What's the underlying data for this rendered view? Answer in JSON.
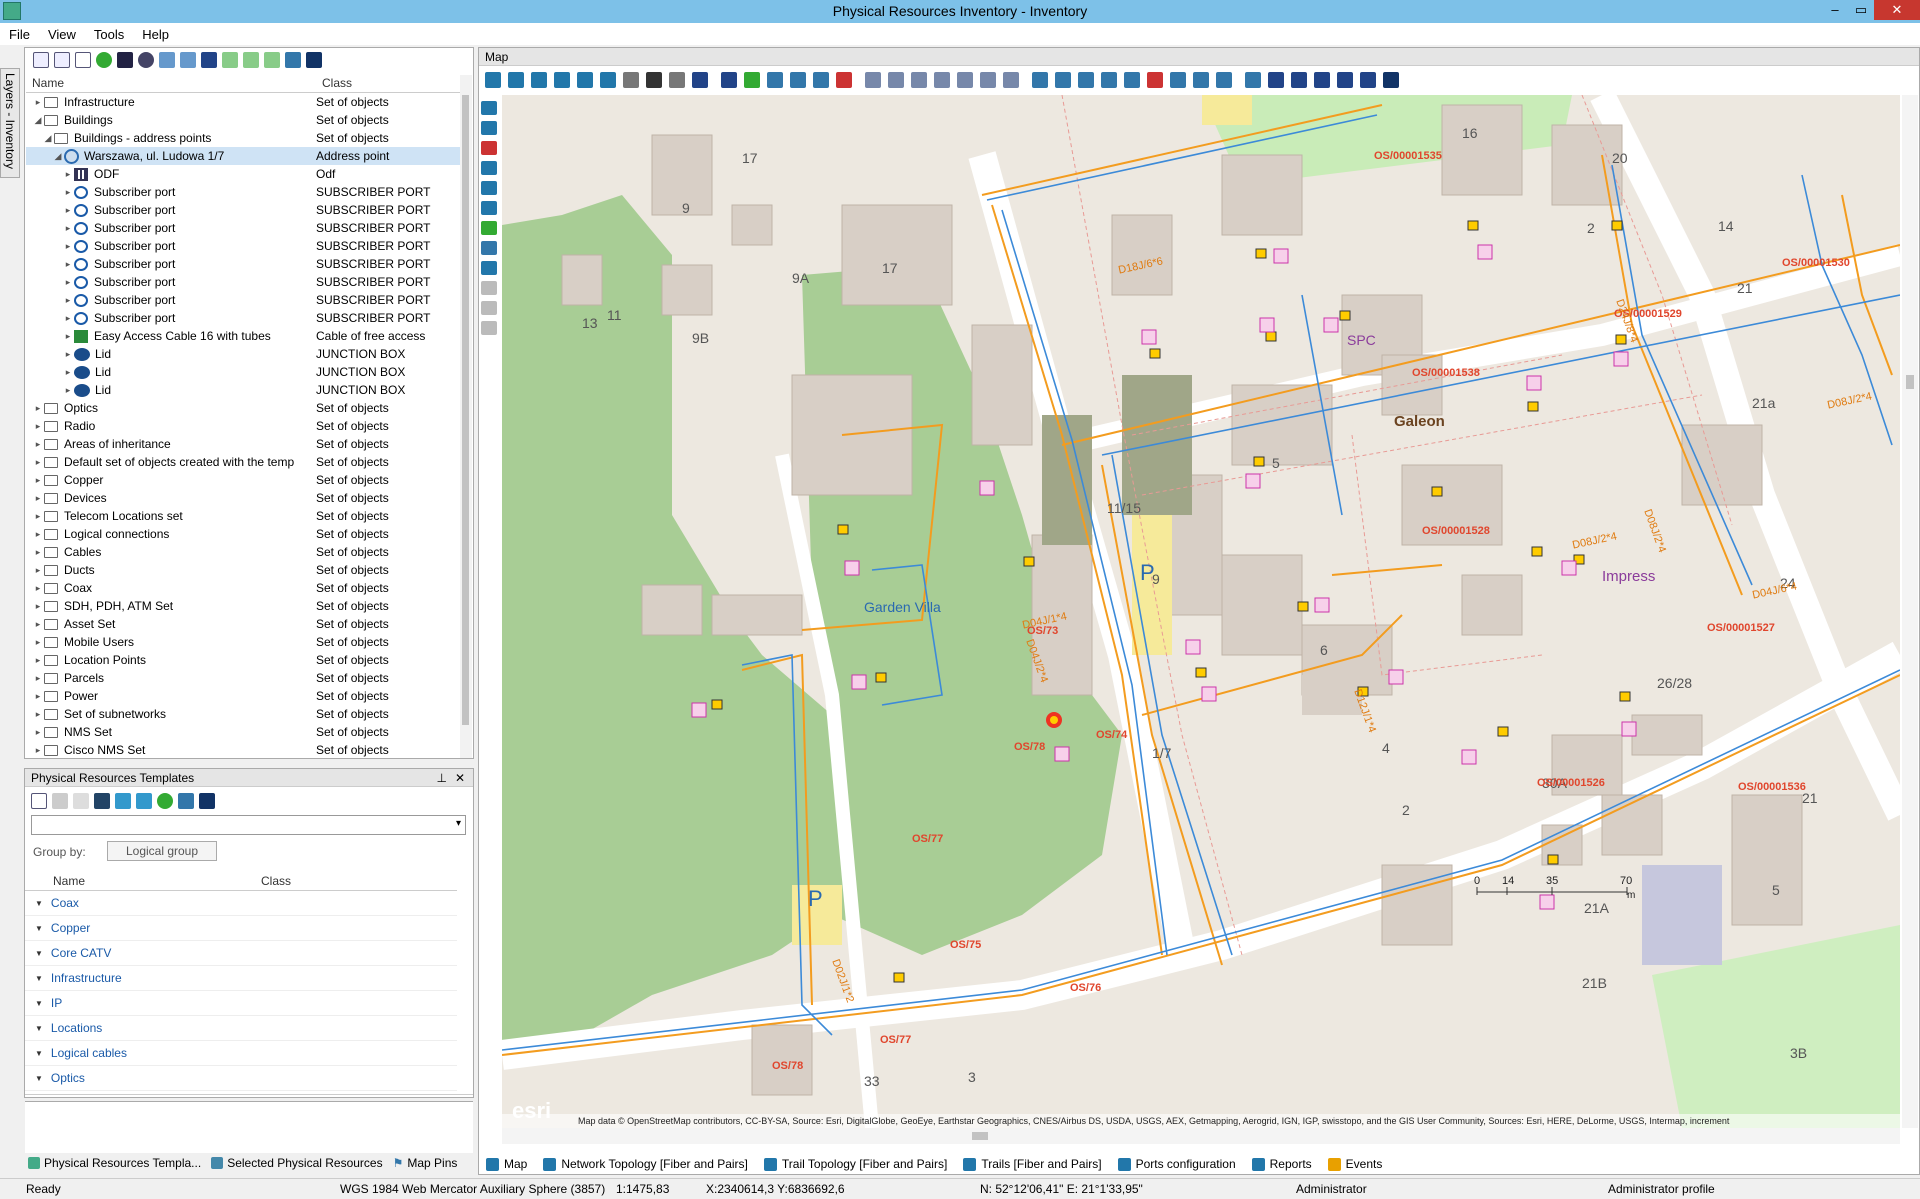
{
  "window": {
    "title": "Physical Resources Inventory - Inventory",
    "min": "–",
    "max": "▭",
    "close": "✕"
  },
  "menu": {
    "items": [
      "File",
      "View",
      "Tools",
      "Help"
    ]
  },
  "sidetab": {
    "label": "Layers - Inventory"
  },
  "tree": {
    "col_name": "Name",
    "col_class": "Class",
    "rows": [
      {
        "name": "Infrastructure",
        "class": "Set of objects",
        "depth": 0,
        "icon": "folder",
        "arrow": "▸"
      },
      {
        "name": "Buildings",
        "class": "Set of objects",
        "depth": 0,
        "icon": "folder",
        "arrow": "◢"
      },
      {
        "name": "Buildings - address points",
        "class": "Set of objects",
        "depth": 1,
        "icon": "folder",
        "arrow": "◢"
      },
      {
        "name": "Warszawa, ul. Ludowa 1/7",
        "class": "Address point",
        "depth": 2,
        "icon": "globe",
        "arrow": "◢",
        "selected": true
      },
      {
        "name": "ODF",
        "class": "Odf",
        "depth": 3,
        "icon": "odf",
        "arrow": "▸"
      },
      {
        "name": "Subscriber port",
        "class": "SUBSCRIBER PORT",
        "depth": 3,
        "icon": "port",
        "arrow": "▸"
      },
      {
        "name": "Subscriber port",
        "class": "SUBSCRIBER PORT",
        "depth": 3,
        "icon": "port",
        "arrow": "▸"
      },
      {
        "name": "Subscriber port",
        "class": "SUBSCRIBER PORT",
        "depth": 3,
        "icon": "port",
        "arrow": "▸"
      },
      {
        "name": "Subscriber port",
        "class": "SUBSCRIBER PORT",
        "depth": 3,
        "icon": "port",
        "arrow": "▸"
      },
      {
        "name": "Subscriber port",
        "class": "SUBSCRIBER PORT",
        "depth": 3,
        "icon": "port",
        "arrow": "▸"
      },
      {
        "name": "Subscriber port",
        "class": "SUBSCRIBER PORT",
        "depth": 3,
        "icon": "port",
        "arrow": "▸"
      },
      {
        "name": "Subscriber port",
        "class": "SUBSCRIBER PORT",
        "depth": 3,
        "icon": "port",
        "arrow": "▸"
      },
      {
        "name": "Subscriber port",
        "class": "SUBSCRIBER PORT",
        "depth": 3,
        "icon": "port",
        "arrow": "▸"
      },
      {
        "name": "Easy Access Cable 16 with tubes",
        "class": "Cable of free access",
        "depth": 3,
        "icon": "cable",
        "arrow": "▸"
      },
      {
        "name": "Lid",
        "class": "JUNCTION BOX",
        "depth": 3,
        "icon": "jbox",
        "arrow": "▸"
      },
      {
        "name": "Lid",
        "class": "JUNCTION BOX",
        "depth": 3,
        "icon": "jbox",
        "arrow": "▸"
      },
      {
        "name": "Lid",
        "class": "JUNCTION BOX",
        "depth": 3,
        "icon": "jbox",
        "arrow": "▸"
      },
      {
        "name": "Optics",
        "class": "Set of objects",
        "depth": 0,
        "icon": "folder",
        "arrow": "▸"
      },
      {
        "name": "Radio",
        "class": "Set of objects",
        "depth": 0,
        "icon": "folder",
        "arrow": "▸"
      },
      {
        "name": "Areas of inheritance",
        "class": "Set of objects",
        "depth": 0,
        "icon": "folder",
        "arrow": "▸"
      },
      {
        "name": "Default set of objects created with the temp",
        "class": "Set of objects",
        "depth": 0,
        "icon": "folder",
        "arrow": "▸"
      },
      {
        "name": "Copper",
        "class": "Set of objects",
        "depth": 0,
        "icon": "folder",
        "arrow": "▸"
      },
      {
        "name": "Devices",
        "class": "Set of objects",
        "depth": 0,
        "icon": "folder",
        "arrow": "▸"
      },
      {
        "name": "Telecom Locations set",
        "class": "Set of objects",
        "depth": 0,
        "icon": "folder",
        "arrow": "▸"
      },
      {
        "name": "Logical connections",
        "class": "Set of objects",
        "depth": 0,
        "icon": "folder",
        "arrow": "▸"
      },
      {
        "name": "Cables",
        "class": "Set of objects",
        "depth": 0,
        "icon": "folder",
        "arrow": "▸"
      },
      {
        "name": "Ducts",
        "class": "Set of objects",
        "depth": 0,
        "icon": "folder",
        "arrow": "▸"
      },
      {
        "name": "Coax",
        "class": "Set of objects",
        "depth": 0,
        "icon": "folder",
        "arrow": "▸"
      },
      {
        "name": "SDH, PDH, ATM Set",
        "class": "Set of objects",
        "depth": 0,
        "icon": "folder",
        "arrow": "▸"
      },
      {
        "name": "Asset Set",
        "class": "Set of objects",
        "depth": 0,
        "icon": "folder",
        "arrow": "▸"
      },
      {
        "name": "Mobile Users",
        "class": "Set of objects",
        "depth": 0,
        "icon": "folder",
        "arrow": "▸"
      },
      {
        "name": "Location Points",
        "class": "Set of objects",
        "depth": 0,
        "icon": "folder",
        "arrow": "▸"
      },
      {
        "name": "Parcels",
        "class": "Set of objects",
        "depth": 0,
        "icon": "folder",
        "arrow": "▸"
      },
      {
        "name": "Power",
        "class": "Set of objects",
        "depth": 0,
        "icon": "folder",
        "arrow": "▸"
      },
      {
        "name": "Set of subnetworks",
        "class": "Set of objects",
        "depth": 0,
        "icon": "folder",
        "arrow": "▸"
      },
      {
        "name": "NMS Set",
        "class": "Set of objects",
        "depth": 0,
        "icon": "folder",
        "arrow": "▸"
      },
      {
        "name": "Cisco NMS Set",
        "class": "Set of objects",
        "depth": 0,
        "icon": "folder",
        "arrow": "▸"
      }
    ]
  },
  "templates": {
    "title": "Physical Resources Templates",
    "pin": "⊥",
    "close": "✕",
    "group_by_label": "Group by:",
    "group_by_value": "Logical group",
    "col_name": "Name",
    "col_class": "Class",
    "groups": [
      "Coax",
      "Copper",
      "Core CATV",
      "Infrastructure",
      "IP",
      "Locations",
      "Logical cables",
      "Optics"
    ]
  },
  "left_tabs": [
    "Physical Resources Templa...",
    "Selected Physical Resources",
    "Map Pins"
  ],
  "map": {
    "title": "Map",
    "attribution": "Map data © OpenStreetMap contributors, CC-BY-SA, Source: Esri, DigitalGlobe, GeoEye, Earthstar Geographics, CNES/Airbus DS, USDA, USGS, AEX, Getmapping, Aerogrid, IGN, IGP, swisstopo, and the GIS User Community, Sources: Esri, HERE, DeLorme, USGS, Intermap, increment",
    "esri": "esri",
    "scale_labels": [
      "0",
      "14",
      "35",
      "70"
    ],
    "scale_unit": "m",
    "place_labels": [
      "Garden Villa",
      "SPC",
      "Galeon",
      "Impress",
      "P",
      "P"
    ],
    "house_numbers": [
      "16",
      "20",
      "9",
      "17",
      "17",
      "9A",
      "2",
      "13",
      "11",
      "9B",
      "21",
      "21a",
      "5",
      "11/15",
      "9",
      "6",
      "1/7",
      "4",
      "2",
      "30A",
      "26/28",
      "24",
      "21",
      "5",
      "21A",
      "21B",
      "3B",
      "3",
      "33",
      "14"
    ],
    "tags": [
      "OS/00001535",
      "OS/00001530",
      "OS/00001529",
      "OS/00001538",
      "OS/00001528",
      "OS/00001527",
      "OS/00001526",
      "OS/00001536",
      "OS/73",
      "OS/74",
      "OS/78",
      "OS/77",
      "OS/77",
      "OS/76",
      "OS/78",
      "OS/75"
    ],
    "cable_labels": [
      "D18J/6*6",
      "D24J/8*4",
      "D08J/2*4",
      "D04J/2*4",
      "D04J/1*4",
      "D02J/1*2",
      "D08J/2*4",
      "D08J/2*4",
      "D04J/6*4",
      "D12J/1*4"
    ]
  },
  "map_tabs": [
    "Map",
    "Network Topology [Fiber and Pairs]",
    "Trail Topology [Fiber and Pairs]",
    "Trails [Fiber and Pairs]",
    "Ports configuration",
    "Reports",
    "Events"
  ],
  "status": {
    "ready": "Ready",
    "projection": "WGS 1984 Web Mercator Auxiliary Sphere (3857)",
    "scale": "1:1475,83",
    "xy": "X:2340614,3 Y:6836692,6",
    "latlon": "N: 52°12'06,41\" E: 21°1'33,95\"",
    "user": "Administrator",
    "profile": "Administrator profile"
  },
  "colors": {
    "accent": "#7dc1e8",
    "selected": "#cfe3f5",
    "link": "#1a5aa8",
    "cable_orange": "#f39c1f",
    "cable_blue": "#3c8ad8",
    "tag_red": "#e0462d"
  }
}
